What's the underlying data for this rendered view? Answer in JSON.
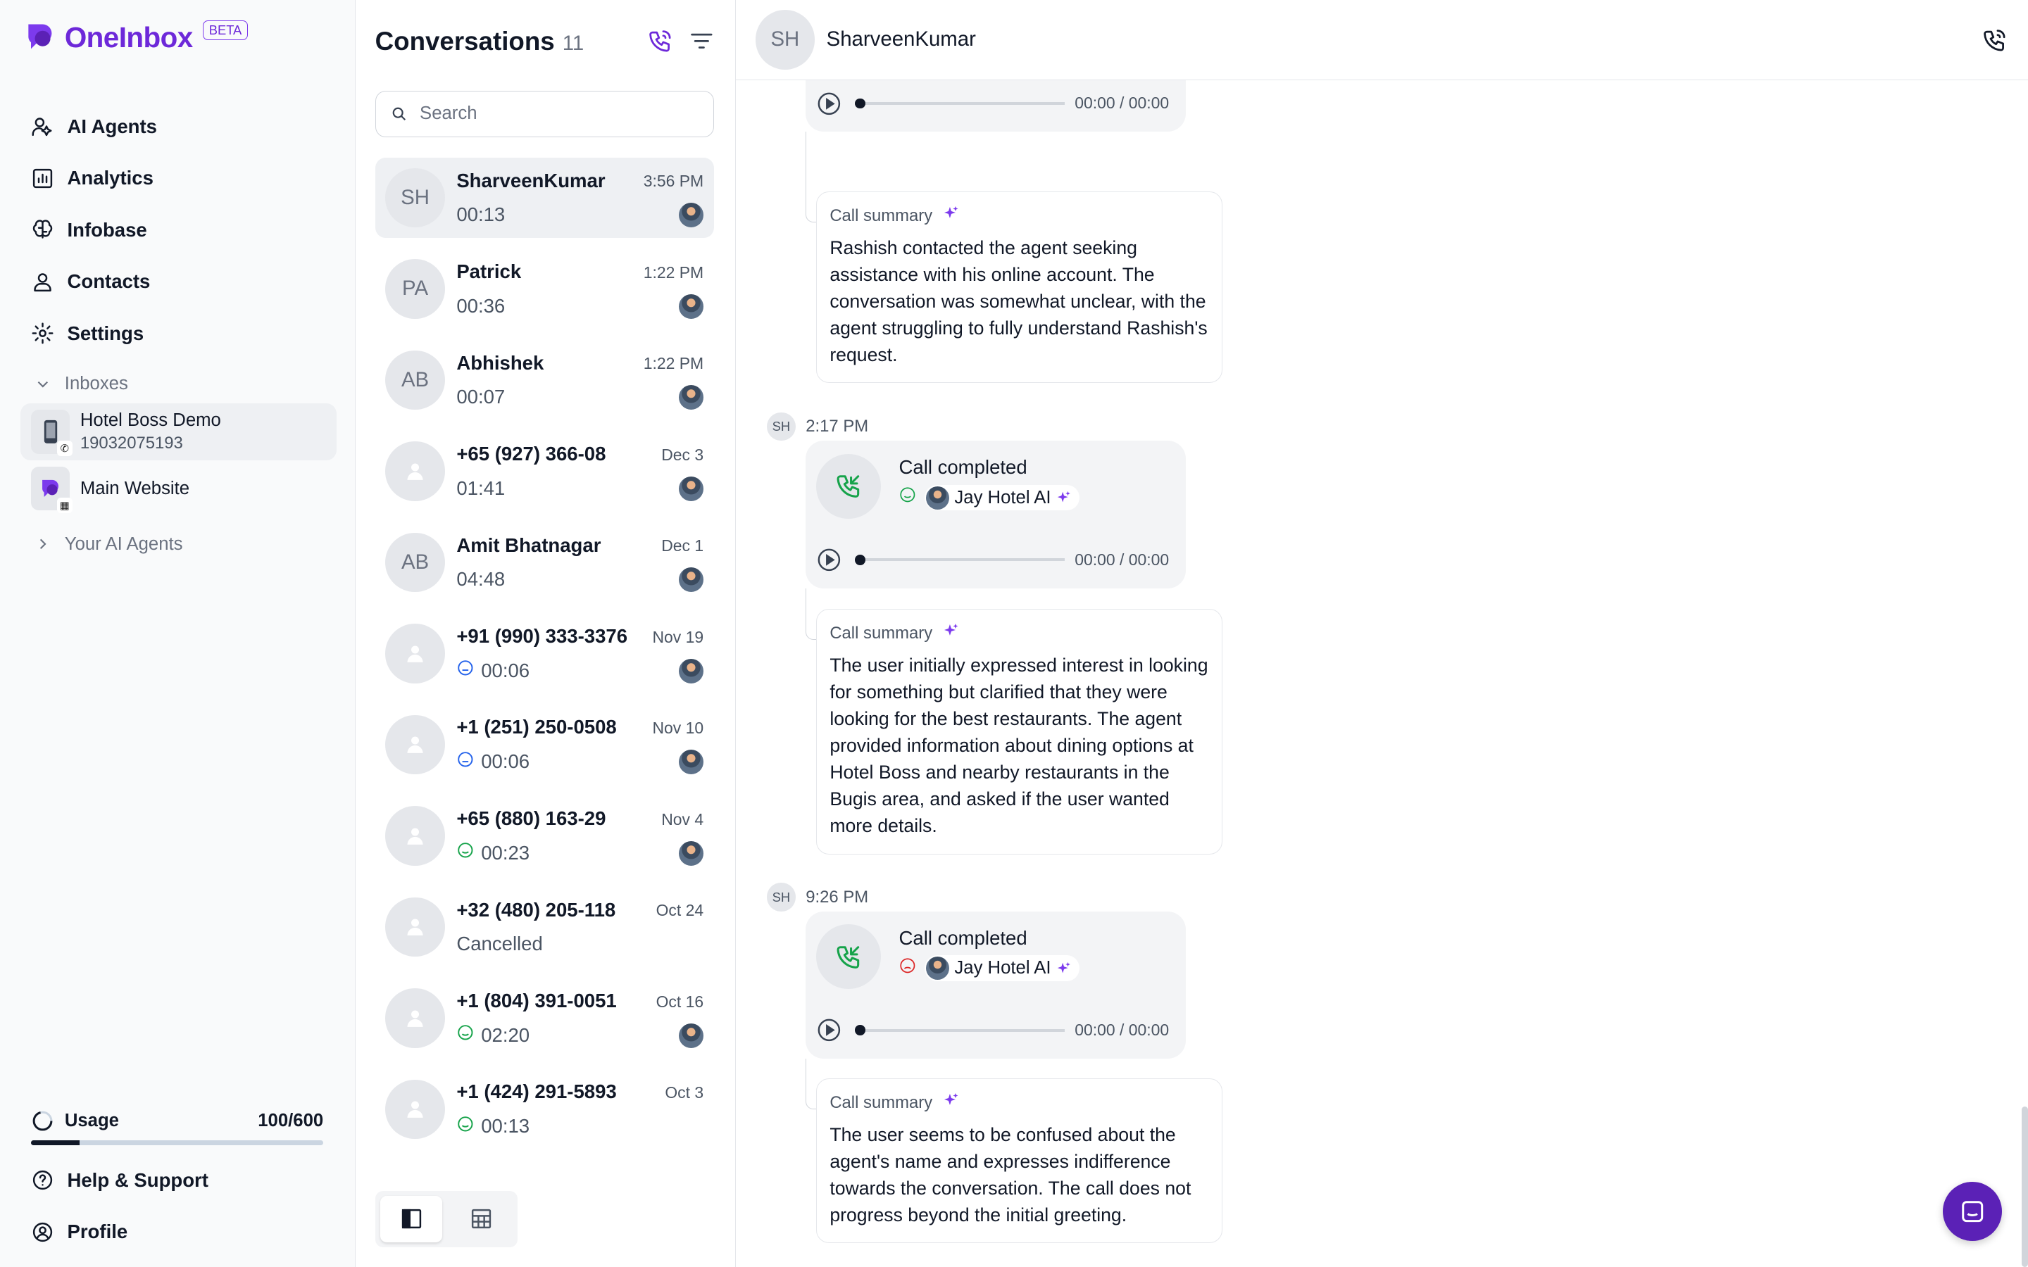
{
  "brand": {
    "name": "OneInbox",
    "badge": "BETA",
    "accent": "#6d28d9"
  },
  "sidebar": {
    "nav": [
      {
        "label": "AI Agents",
        "icon": "user-bot-icon"
      },
      {
        "label": "Analytics",
        "icon": "chart-bar-icon"
      },
      {
        "label": "Infobase",
        "icon": "brain-icon"
      },
      {
        "label": "Contacts",
        "icon": "user-icon"
      },
      {
        "label": "Settings",
        "icon": "gear-icon"
      }
    ],
    "inboxes_label": "Inboxes",
    "inboxes": [
      {
        "name": "Hotel Boss Demo",
        "number": "19032075193",
        "icon": "phone-device-icon"
      },
      {
        "name": "Main Website",
        "icon": "website-widget-icon"
      }
    ],
    "your_agents_label": "Your AI Agents",
    "usage": {
      "label": "Usage",
      "value": "100/600",
      "fraction": 0.1667
    },
    "bottom_nav": [
      {
        "label": "Help & Support",
        "icon": "help-circle-icon"
      },
      {
        "label": "Profile",
        "icon": "profile-circle-icon"
      }
    ]
  },
  "conversations": {
    "title": "Conversations",
    "count": "11",
    "search_placeholder": "Search",
    "items": [
      {
        "initials": "SH",
        "name": "SharveenKumar",
        "time": "3:56 PM",
        "sub": "00:13",
        "sentiment": "",
        "agent": true
      },
      {
        "initials": "PA",
        "name": "Patrick",
        "time": "1:22 PM",
        "sub": "00:36",
        "sentiment": "",
        "agent": true
      },
      {
        "initials": "AB",
        "name": "Abhishek",
        "time": "1:22 PM",
        "sub": "00:07",
        "sentiment": "",
        "agent": true
      },
      {
        "initials": "",
        "name": "+65 (927) 366-08",
        "time": "Dec 3",
        "sub": "01:41",
        "sentiment": "",
        "agent": true
      },
      {
        "initials": "AB",
        "name": "Amit Bhatnagar",
        "time": "Dec 1",
        "sub": "04:48",
        "sentiment": "",
        "agent": true
      },
      {
        "initials": "",
        "name": "+91 (990) 333-3376",
        "time": "Nov 19",
        "sub": "00:06",
        "sentiment": "neutral",
        "agent": true
      },
      {
        "initials": "",
        "name": "+1 (251) 250-0508",
        "time": "Nov 10",
        "sub": "00:06",
        "sentiment": "neutral",
        "agent": true
      },
      {
        "initials": "",
        "name": "+65 (880) 163-29",
        "time": "Nov 4",
        "sub": "00:23",
        "sentiment": "positive",
        "agent": true
      },
      {
        "initials": "",
        "name": "+32 (480) 205-118",
        "time": "Oct 24",
        "sub": "Cancelled",
        "sentiment": "",
        "agent": false
      },
      {
        "initials": "",
        "name": "+1 (804) 391-0051",
        "time": "Oct 16",
        "sub": "02:20",
        "sentiment": "positive",
        "agent": true
      },
      {
        "initials": "",
        "name": "+1 (424) 291-5893",
        "time": "Oct 3",
        "sub": "00:13",
        "sentiment": "positive",
        "agent": false
      }
    ]
  },
  "chat": {
    "initials": "SH",
    "name": "SharveenKumar",
    "agent_name": "Jay Hotel AI",
    "player_time": "00:00 / 00:00",
    "summary_label": "Call summary",
    "call_label": "Call completed",
    "calls": [
      {
        "time": "",
        "title": "",
        "sentiment": "neutral",
        "summary": "Rashish contacted the agent seeking assistance with his online account. The conversation was somewhat unclear, with the agent struggling to fully understand Rashish's request."
      },
      {
        "time": "2:17 PM",
        "title": "Call completed",
        "sentiment": "positive",
        "summary": "The user initially expressed interest in looking for something but clarified that they were looking for the best restaurants. The agent provided information about dining options at Hotel Boss and nearby restaurants in the Bugis area, and asked if the user wanted more details."
      },
      {
        "time": "9:26 PM",
        "title": "Call completed",
        "sentiment": "negative",
        "summary": "The user seems to be confused about the agent's name and expresses indifference towards the conversation. The call does not progress beyond the initial greeting."
      }
    ]
  },
  "colors": {
    "positive": "#16a34a",
    "neutral": "#2563eb",
    "negative": "#dc2626",
    "spark": "#7c3aed",
    "fab": "#5b21b6"
  }
}
